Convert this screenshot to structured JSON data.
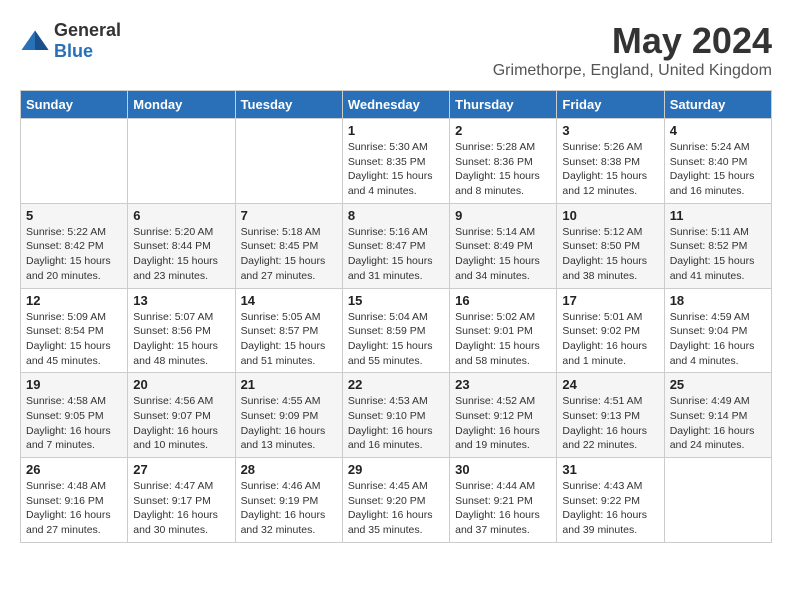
{
  "header": {
    "logo_general": "General",
    "logo_blue": "Blue",
    "month_title": "May 2024",
    "location": "Grimethorpe, England, United Kingdom"
  },
  "days_of_week": [
    "Sunday",
    "Monday",
    "Tuesday",
    "Wednesday",
    "Thursday",
    "Friday",
    "Saturday"
  ],
  "weeks": [
    [
      {
        "day": "",
        "info": ""
      },
      {
        "day": "",
        "info": ""
      },
      {
        "day": "",
        "info": ""
      },
      {
        "day": "1",
        "info": "Sunrise: 5:30 AM\nSunset: 8:35 PM\nDaylight: 15 hours\nand 4 minutes."
      },
      {
        "day": "2",
        "info": "Sunrise: 5:28 AM\nSunset: 8:36 PM\nDaylight: 15 hours\nand 8 minutes."
      },
      {
        "day": "3",
        "info": "Sunrise: 5:26 AM\nSunset: 8:38 PM\nDaylight: 15 hours\nand 12 minutes."
      },
      {
        "day": "4",
        "info": "Sunrise: 5:24 AM\nSunset: 8:40 PM\nDaylight: 15 hours\nand 16 minutes."
      }
    ],
    [
      {
        "day": "5",
        "info": "Sunrise: 5:22 AM\nSunset: 8:42 PM\nDaylight: 15 hours\nand 20 minutes."
      },
      {
        "day": "6",
        "info": "Sunrise: 5:20 AM\nSunset: 8:44 PM\nDaylight: 15 hours\nand 23 minutes."
      },
      {
        "day": "7",
        "info": "Sunrise: 5:18 AM\nSunset: 8:45 PM\nDaylight: 15 hours\nand 27 minutes."
      },
      {
        "day": "8",
        "info": "Sunrise: 5:16 AM\nSunset: 8:47 PM\nDaylight: 15 hours\nand 31 minutes."
      },
      {
        "day": "9",
        "info": "Sunrise: 5:14 AM\nSunset: 8:49 PM\nDaylight: 15 hours\nand 34 minutes."
      },
      {
        "day": "10",
        "info": "Sunrise: 5:12 AM\nSunset: 8:50 PM\nDaylight: 15 hours\nand 38 minutes."
      },
      {
        "day": "11",
        "info": "Sunrise: 5:11 AM\nSunset: 8:52 PM\nDaylight: 15 hours\nand 41 minutes."
      }
    ],
    [
      {
        "day": "12",
        "info": "Sunrise: 5:09 AM\nSunset: 8:54 PM\nDaylight: 15 hours\nand 45 minutes."
      },
      {
        "day": "13",
        "info": "Sunrise: 5:07 AM\nSunset: 8:56 PM\nDaylight: 15 hours\nand 48 minutes."
      },
      {
        "day": "14",
        "info": "Sunrise: 5:05 AM\nSunset: 8:57 PM\nDaylight: 15 hours\nand 51 minutes."
      },
      {
        "day": "15",
        "info": "Sunrise: 5:04 AM\nSunset: 8:59 PM\nDaylight: 15 hours\nand 55 minutes."
      },
      {
        "day": "16",
        "info": "Sunrise: 5:02 AM\nSunset: 9:01 PM\nDaylight: 15 hours\nand 58 minutes."
      },
      {
        "day": "17",
        "info": "Sunrise: 5:01 AM\nSunset: 9:02 PM\nDaylight: 16 hours\nand 1 minute."
      },
      {
        "day": "18",
        "info": "Sunrise: 4:59 AM\nSunset: 9:04 PM\nDaylight: 16 hours\nand 4 minutes."
      }
    ],
    [
      {
        "day": "19",
        "info": "Sunrise: 4:58 AM\nSunset: 9:05 PM\nDaylight: 16 hours\nand 7 minutes."
      },
      {
        "day": "20",
        "info": "Sunrise: 4:56 AM\nSunset: 9:07 PM\nDaylight: 16 hours\nand 10 minutes."
      },
      {
        "day": "21",
        "info": "Sunrise: 4:55 AM\nSunset: 9:09 PM\nDaylight: 16 hours\nand 13 minutes."
      },
      {
        "day": "22",
        "info": "Sunrise: 4:53 AM\nSunset: 9:10 PM\nDaylight: 16 hours\nand 16 minutes."
      },
      {
        "day": "23",
        "info": "Sunrise: 4:52 AM\nSunset: 9:12 PM\nDaylight: 16 hours\nand 19 minutes."
      },
      {
        "day": "24",
        "info": "Sunrise: 4:51 AM\nSunset: 9:13 PM\nDaylight: 16 hours\nand 22 minutes."
      },
      {
        "day": "25",
        "info": "Sunrise: 4:49 AM\nSunset: 9:14 PM\nDaylight: 16 hours\nand 24 minutes."
      }
    ],
    [
      {
        "day": "26",
        "info": "Sunrise: 4:48 AM\nSunset: 9:16 PM\nDaylight: 16 hours\nand 27 minutes."
      },
      {
        "day": "27",
        "info": "Sunrise: 4:47 AM\nSunset: 9:17 PM\nDaylight: 16 hours\nand 30 minutes."
      },
      {
        "day": "28",
        "info": "Sunrise: 4:46 AM\nSunset: 9:19 PM\nDaylight: 16 hours\nand 32 minutes."
      },
      {
        "day": "29",
        "info": "Sunrise: 4:45 AM\nSunset: 9:20 PM\nDaylight: 16 hours\nand 35 minutes."
      },
      {
        "day": "30",
        "info": "Sunrise: 4:44 AM\nSunset: 9:21 PM\nDaylight: 16 hours\nand 37 minutes."
      },
      {
        "day": "31",
        "info": "Sunrise: 4:43 AM\nSunset: 9:22 PM\nDaylight: 16 hours\nand 39 minutes."
      },
      {
        "day": "",
        "info": ""
      }
    ]
  ]
}
